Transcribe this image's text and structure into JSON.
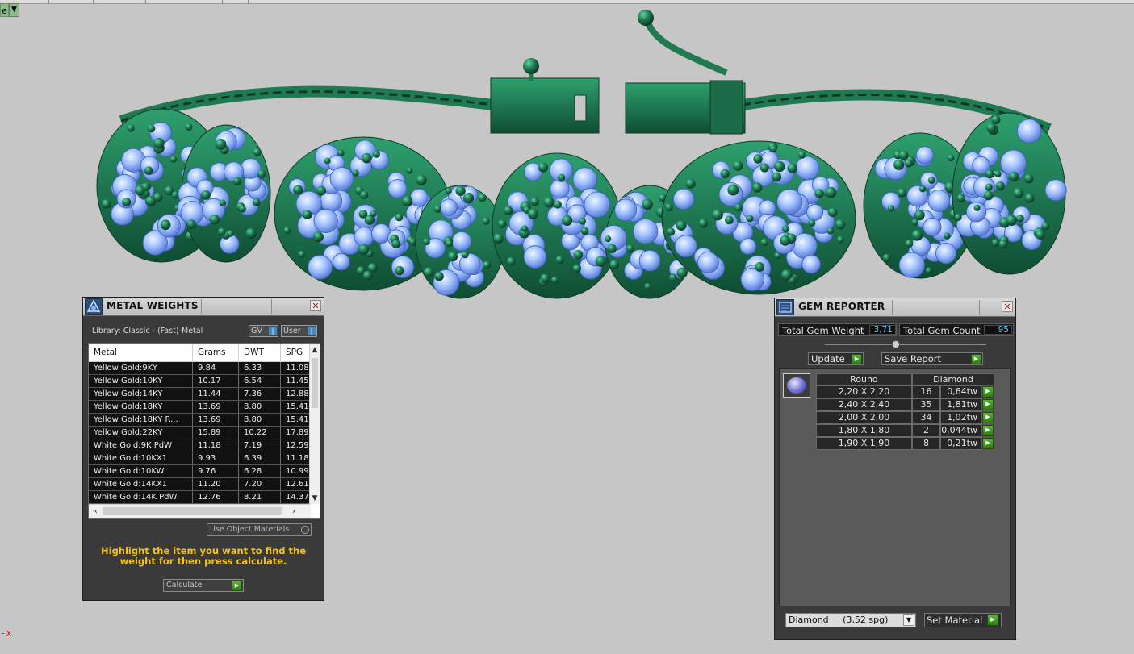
{
  "window": {
    "corner_label": "e",
    "axis_label": "-x"
  },
  "colors": {
    "metal": "#1f7a52",
    "gem": "#8ab4ff",
    "panel_bg": "#3a3a3a",
    "hint": "#f2c41a",
    "gem_value": "#5fc8ee"
  },
  "metal_weights": {
    "title": "METAL WEIGHTS",
    "library": "Library: Classic - (Fast)-Metal",
    "toggle_gv": "GV",
    "toggle_user": "User",
    "columns": [
      "Metal",
      "Grams",
      "DWT",
      "SPG"
    ],
    "rows": [
      [
        "Yellow Gold:9KY",
        "9.84",
        "6.33",
        "11.08"
      ],
      [
        "Yellow Gold:10KY",
        "10.17",
        "6.54",
        "11.45"
      ],
      [
        "Yellow Gold:14KY",
        "11.44",
        "7.36",
        "12.88"
      ],
      [
        "Yellow Gold:18KY",
        "13.69",
        "8.80",
        "15.41"
      ],
      [
        "Yellow Gold:18KY R...",
        "13.69",
        "8.80",
        "15.41"
      ],
      [
        "Yellow Gold:22KY",
        "15.89",
        "10.22",
        "17.89"
      ],
      [
        "White Gold:9K PdW",
        "11.18",
        "7.19",
        "12.59"
      ],
      [
        "White Gold:10KX1",
        "9.93",
        "6.39",
        "11.18"
      ],
      [
        "White Gold:10KW",
        "9.76",
        "6.28",
        "10.99"
      ],
      [
        "White Gold:14KX1",
        "11.20",
        "7.20",
        "12.61"
      ],
      [
        "White Gold:14K PdW",
        "12.76",
        "8.21",
        "14.37"
      ]
    ],
    "use_object_materials": "Use Object Materials",
    "hint": "Highlight the item you want to find the weight for then press calculate.",
    "calculate": "Calculate"
  },
  "gem_reporter": {
    "title": "GEM REPORTER",
    "total_weight_label": "Total Gem Weight",
    "total_weight": "3,71",
    "total_count_label": "Total Gem Count",
    "total_count": "95",
    "update": "Update",
    "save_report": "Save Report",
    "col_shape": "Round",
    "col_type": "Diamond",
    "rows": [
      {
        "size": "2,20 X 2,20",
        "count": "16",
        "weight": "0,64tw"
      },
      {
        "size": "2,40 X 2,40",
        "count": "35",
        "weight": "1,81tw"
      },
      {
        "size": "2,00 X 2,00",
        "count": "34",
        "weight": "1,02tw"
      },
      {
        "size": "1,80 X 1,80",
        "count": "2",
        "weight": "0,044tw"
      },
      {
        "size": "1,90 X 1,90",
        "count": "8",
        "weight": "0,21tw"
      }
    ],
    "material": "Diamond     (3,52 spg)",
    "set_material": "Set Material"
  }
}
